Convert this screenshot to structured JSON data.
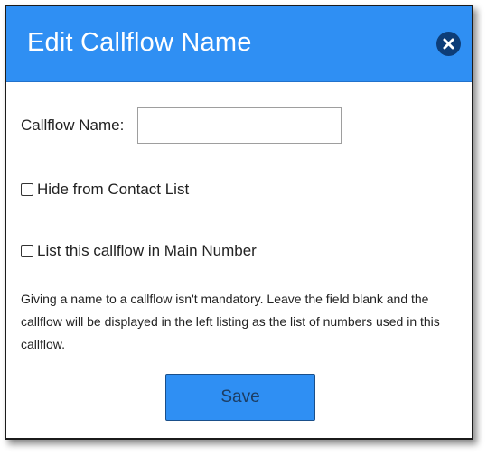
{
  "dialog": {
    "title": "Edit Callflow Name",
    "close_icon": "close-circle-icon",
    "colors": {
      "header": "#2f8ff3",
      "close_button": "#0d3d78",
      "save_button": "#2f8ff3"
    }
  },
  "form": {
    "name_label": "Callflow Name:",
    "name_value": "",
    "name_placeholder": "",
    "hide_contact_label": "Hide from Contact List",
    "hide_contact_checked": false,
    "main_number_label": "List this callflow in Main Number",
    "main_number_checked": false,
    "help_text": "Giving a name to a callflow isn't mandatory. Leave the field blank and the callflow will be displayed in the left listing as the list of numbers used in this callflow.",
    "save_label": "Save"
  }
}
